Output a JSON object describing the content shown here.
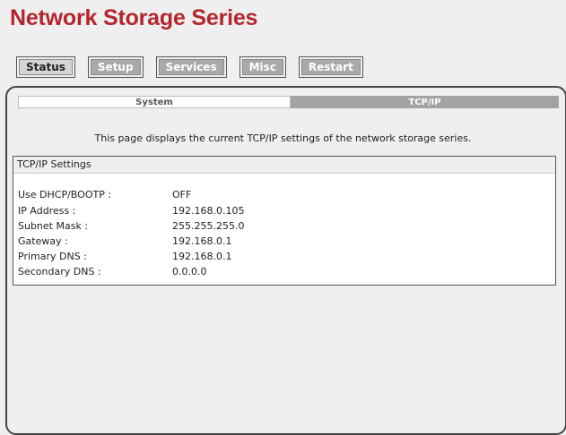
{
  "app": {
    "title": "Network Storage Series"
  },
  "nav": {
    "items": [
      "Status",
      "Setup",
      "Services",
      "Misc",
      "Restart"
    ],
    "active": "Status"
  },
  "tabs": {
    "system": "System",
    "tcpip": "TCP/IP"
  },
  "description": "This page displays the current TCP/IP settings of the network storage series.",
  "settings": {
    "header": "TCP/IP Settings",
    "rows": [
      {
        "label": "Use DHCP/BOOTP :",
        "value": "OFF"
      },
      {
        "label": "IP Address :",
        "value": "192.168.0.105"
      },
      {
        "label": "Subnet Mask :",
        "value": "255.255.255.0"
      },
      {
        "label": "Gateway :",
        "value": "192.168.0.1"
      },
      {
        "label": "Primary DNS :",
        "value": "192.168.0.1"
      },
      {
        "label": "Secondary DNS :",
        "value": "0.0.0.0"
      }
    ]
  },
  "colors": {
    "brand_red": "#b3262c",
    "button_gray": "#a9a9a9",
    "tab_gray": "#a3a3a3"
  }
}
